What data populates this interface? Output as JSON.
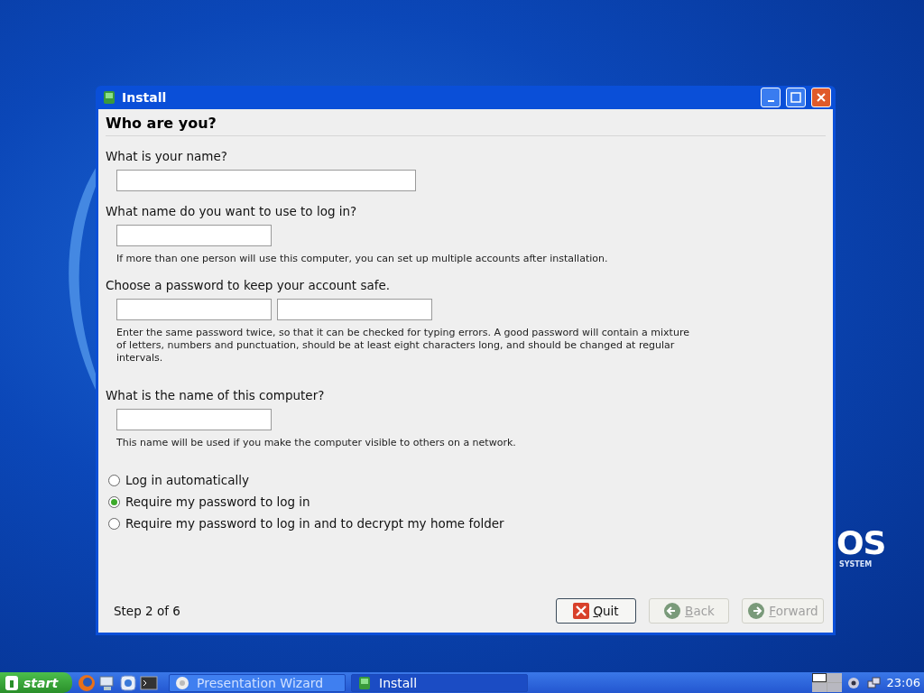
{
  "desktop": {
    "logo_text": "OS",
    "tagline": "SYSTEM"
  },
  "window": {
    "title": "Install",
    "heading": "Who are you?",
    "sections": [
      {
        "question": "What is your name?",
        "fields": [
          {
            "kind": "wide"
          }
        ]
      },
      {
        "question": "What name do you want to use to log in?",
        "fields": [
          {
            "kind": "short"
          }
        ],
        "hint": "If more than one person will use this computer, you can set up multiple accounts after installation."
      },
      {
        "question": "Choose a password to keep your account safe.",
        "fields": [
          {
            "kind": "short"
          },
          {
            "kind": "short"
          }
        ],
        "hint": "Enter the same password twice, so that it can be checked for typing errors. A good password will contain a mixture of letters, numbers and punctuation, should be at least eight characters long, and should be changed at regular intervals."
      },
      {
        "question": "What is the name of this computer?",
        "fields": [
          {
            "kind": "short"
          }
        ],
        "hint": "This name will be used if you make the computer visible to others on a network."
      }
    ],
    "options": [
      {
        "label": "Log in automatically",
        "selected": false
      },
      {
        "label": "Require my password to log in",
        "selected": true
      },
      {
        "label": "Require my password to log in and to decrypt my home folder",
        "selected": false
      }
    ],
    "step": "Step 2 of 6",
    "buttons": [
      {
        "kind": "quit",
        "label": "Quit",
        "disabled": false
      },
      {
        "kind": "back",
        "label": "Back",
        "disabled": true
      },
      {
        "kind": "forward",
        "label": "Forward",
        "disabled": true
      }
    ]
  },
  "taskbar": {
    "start": "start",
    "tasks": [
      {
        "label": "Presentation Wizard",
        "selected": false
      },
      {
        "label": "Install",
        "selected": true
      }
    ],
    "clock": "23:06"
  }
}
